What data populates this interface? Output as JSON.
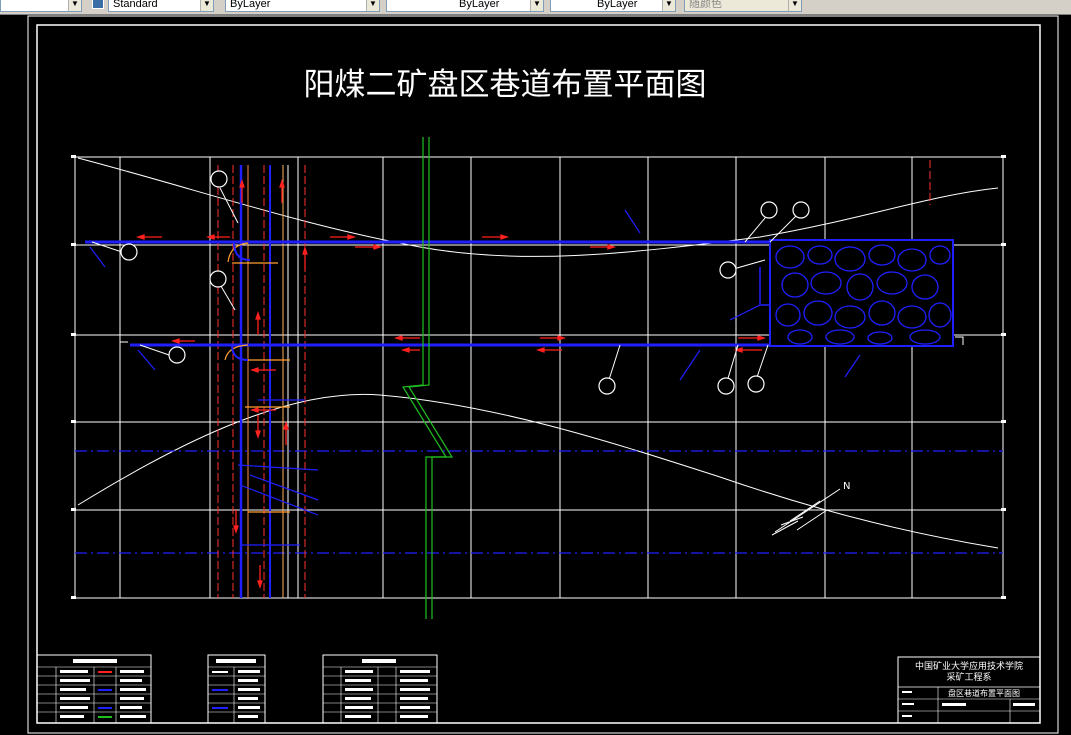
{
  "toolbar": {
    "text_style_value": "Standard",
    "layer_color_value": "ByLayer",
    "linetype_value": "ByLayer",
    "lineweight_value": "ByLayer",
    "plot_style_value": "随颜色"
  },
  "drawing": {
    "title": "阳煤二矿盘区巷道布置平面图",
    "north_label": "N",
    "label_colors": {
      "drawing_bg": "#000000",
      "roadway": "#2020ff",
      "arrow": "#ff2020",
      "center_line": "#20c020"
    }
  },
  "title_block": {
    "school_line1": "中国矿业大学应用技术学院",
    "school_line2": "采矿工程系",
    "drawing_name": "盘区巷道布置平面图"
  }
}
